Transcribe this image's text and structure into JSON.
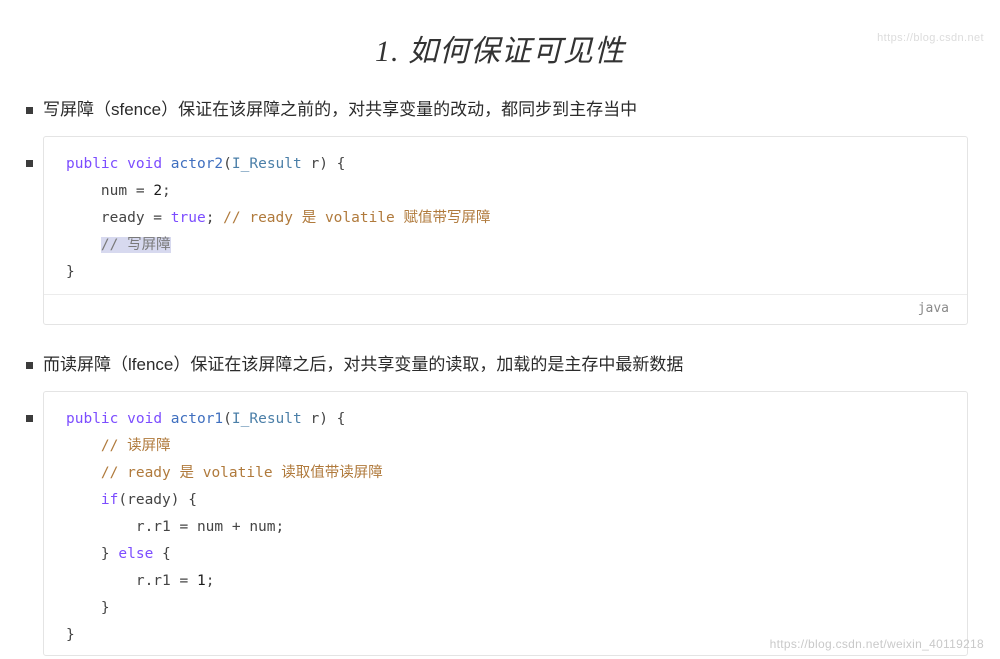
{
  "watermark": {
    "top": "https://blog.csdn.net",
    "bottom": "https://blog.csdn.net/weixin_40119218"
  },
  "title": "1. 如何保证可见性",
  "bullets": {
    "write_barrier": "写屏障（sfence）保证在该屏障之前的，对共享变量的改动，都同步到主存当中",
    "read_barrier": "而读屏障（lfence）保证在该屏障之后，对共享变量的读取，加载的是主存中最新数据"
  },
  "code_blocks": [
    {
      "lang_label": "java",
      "lines": [
        [
          {
            "t": "public",
            "c": "kw"
          },
          {
            "t": " ",
            "c": "plain"
          },
          {
            "t": "void",
            "c": "kw"
          },
          {
            "t": " ",
            "c": "plain"
          },
          {
            "t": "actor2",
            "c": "fn"
          },
          {
            "t": "(",
            "c": "plain"
          },
          {
            "t": "I_Result",
            "c": "type"
          },
          {
            "t": " r) {",
            "c": "plain"
          }
        ],
        [
          {
            "t": "    num = ",
            "c": "plain"
          },
          {
            "t": "2",
            "c": "num"
          },
          {
            "t": ";",
            "c": "plain"
          }
        ],
        [
          {
            "t": "    ready = ",
            "c": "plain"
          },
          {
            "t": "true",
            "c": "kw"
          },
          {
            "t": "; ",
            "c": "plain"
          },
          {
            "t": "// ready 是 volatile 赋值带写屏障",
            "c": "cmt"
          }
        ],
        [
          {
            "t": "    ",
            "c": "plain"
          },
          {
            "t": "// 写屏障",
            "c": "cmt-hl"
          }
        ],
        [
          {
            "t": "}",
            "c": "plain"
          }
        ]
      ]
    },
    {
      "lang_label": "",
      "lines": [
        [
          {
            "t": "public",
            "c": "kw"
          },
          {
            "t": " ",
            "c": "plain"
          },
          {
            "t": "void",
            "c": "kw"
          },
          {
            "t": " ",
            "c": "plain"
          },
          {
            "t": "actor1",
            "c": "fn"
          },
          {
            "t": "(",
            "c": "plain"
          },
          {
            "t": "I_Result",
            "c": "type"
          },
          {
            "t": " r) {",
            "c": "plain"
          }
        ],
        [
          {
            "t": "    ",
            "c": "plain"
          },
          {
            "t": "// 读屏障",
            "c": "cmt"
          }
        ],
        [
          {
            "t": "    ",
            "c": "plain"
          },
          {
            "t": "// ready 是 volatile 读取值带读屏障",
            "c": "cmt"
          }
        ],
        [
          {
            "t": "    ",
            "c": "plain"
          },
          {
            "t": "if",
            "c": "kw"
          },
          {
            "t": "(ready) {",
            "c": "plain"
          }
        ],
        [
          {
            "t": "        r.r1 = num + num;",
            "c": "plain"
          }
        ],
        [
          {
            "t": "    } ",
            "c": "plain"
          },
          {
            "t": "else",
            "c": "kw"
          },
          {
            "t": " {",
            "c": "plain"
          }
        ],
        [
          {
            "t": "        r.r1 = ",
            "c": "plain"
          },
          {
            "t": "1",
            "c": "num"
          },
          {
            "t": ";",
            "c": "plain"
          }
        ],
        [
          {
            "t": "    }",
            "c": "plain"
          }
        ],
        [
          {
            "t": "}",
            "c": "plain"
          }
        ]
      ]
    }
  ]
}
